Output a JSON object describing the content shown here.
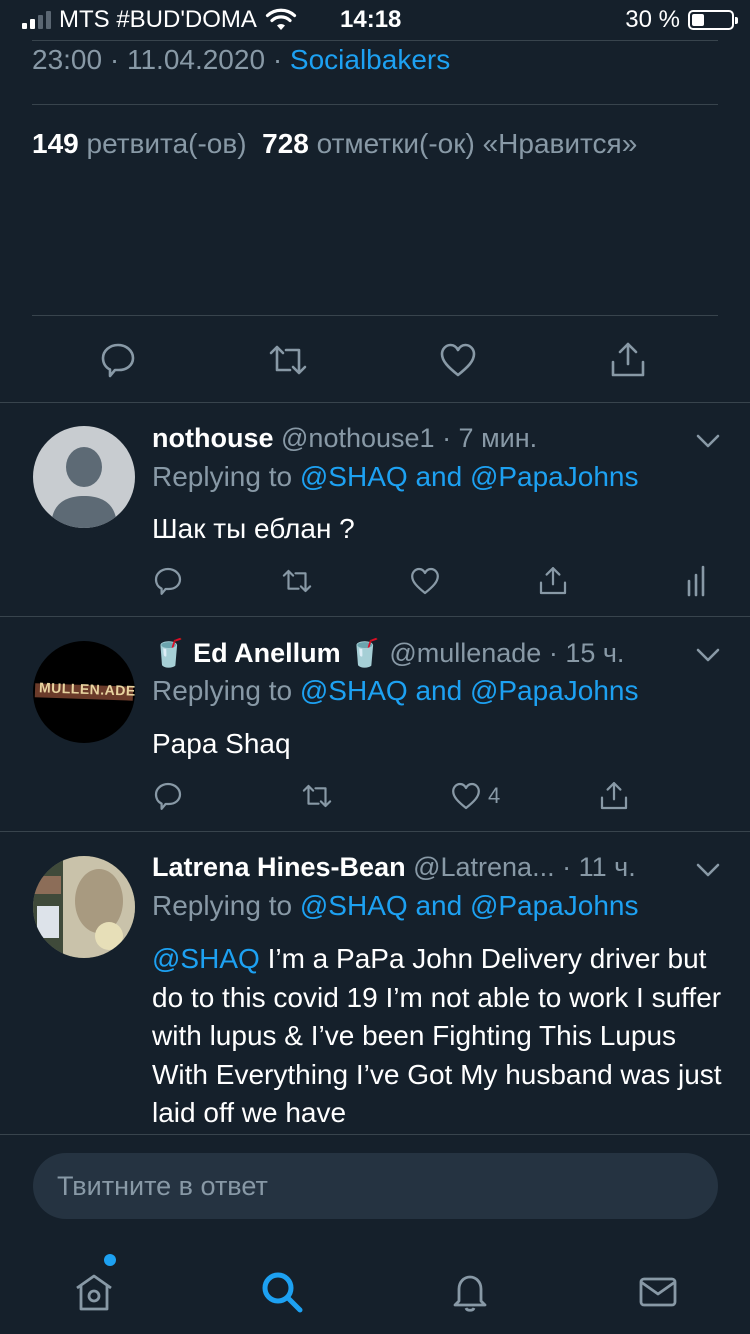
{
  "status_bar": {
    "carrier": "MTS #BUD'DOMA",
    "time": "14:18",
    "battery": "30 %",
    "battery_level": 0.3
  },
  "tweet_meta": {
    "time": "23:00",
    "sep1": "·",
    "date": "11.04.2020",
    "sep2": "·",
    "source": "Socialbakers"
  },
  "stats": {
    "retweets_count": "149",
    "retweets_label": "ретвита(-ов)",
    "likes_count": "728",
    "likes_label": "отметки(-ок) «Нравится»"
  },
  "replies": [
    {
      "name": "nothouse",
      "handle": "@nothouse1",
      "time": "· 7 мин.",
      "replying_prefix": "Replying to",
      "mention1": "@SHAQ",
      "and": "and",
      "mention2": "@PapaJohns",
      "text": "Шак ты еблан ?",
      "likes": ""
    },
    {
      "name_emoji_left": "🥤",
      "name": "Ed Anellum",
      "name_emoji_right": "🥤",
      "handle": "@mullenade",
      "time": "· 15 ч.",
      "replying_prefix": "Replying to",
      "mention1": "@SHAQ",
      "and": "and",
      "mention2": "@PapaJohns",
      "text": "Papa Shaq",
      "likes": "4",
      "avatar_text": "MULLEN.ADE"
    },
    {
      "name": "Latrena Hines-Bean",
      "handle": "@Latrena...",
      "time": "· 11 ч.",
      "replying_prefix": "Replying to",
      "mention1": "@SHAQ",
      "and": "and",
      "mention2": "@PapaJohns",
      "text_mention": "@SHAQ",
      "text": "I’m a PaPa John Delivery driver but do to this covid 19 I’m not able to work I suffer with lupus & I’ve been Fighting This Lupus With Everything I’ve Got My husband was just laid off we have"
    }
  ],
  "compose": {
    "placeholder": "Твитните в ответ"
  },
  "colors": {
    "background": "#15202b",
    "accent": "#1da1f2",
    "secondary_text": "#8899a6",
    "divider": "#38444d"
  },
  "icons": {
    "action_bar": [
      "reply-icon",
      "retweet-icon",
      "like-icon",
      "share-icon"
    ],
    "tab_bar": [
      "home-icon",
      "search-icon",
      "notifications-icon",
      "messages-icon"
    ]
  }
}
